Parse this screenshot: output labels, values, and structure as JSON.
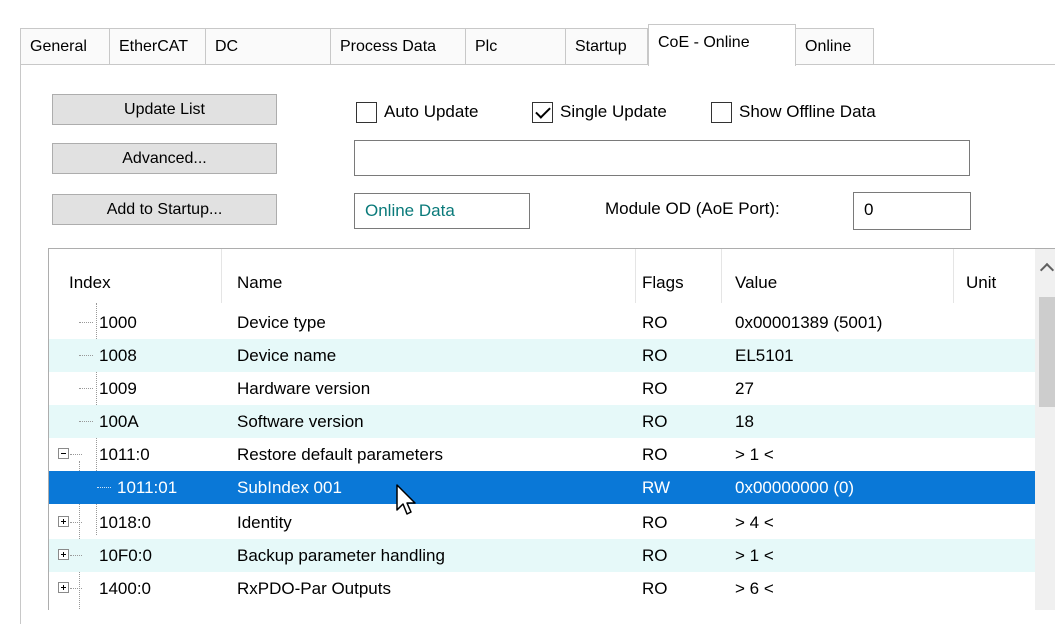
{
  "tabs": [
    {
      "label": "General",
      "active": false
    },
    {
      "label": "EtherCAT",
      "active": false
    },
    {
      "label": "DC",
      "active": false
    },
    {
      "label": "Process Data",
      "active": false
    },
    {
      "label": "Plc",
      "active": false
    },
    {
      "label": "Startup",
      "active": false
    },
    {
      "label": "CoE - Online",
      "active": true
    },
    {
      "label": "Online",
      "active": false
    }
  ],
  "buttons": {
    "update_list": "Update List",
    "advanced": "Advanced...",
    "add_to_startup": "Add to Startup..."
  },
  "checkboxes": {
    "auto_update": {
      "label": "Auto Update",
      "checked": false
    },
    "single_update": {
      "label": "Single Update",
      "checked": true
    },
    "show_offline": {
      "label": "Show Offline Data",
      "checked": false
    }
  },
  "fields": {
    "advanced_text": "",
    "online_data": "Online Data",
    "module_od_label": "Module OD (AoE Port):",
    "module_od_value": "0"
  },
  "table": {
    "headers": {
      "index": "Index",
      "name": "Name",
      "flags": "Flags",
      "value": "Value",
      "unit": "Unit"
    },
    "rows": [
      {
        "index": "1000",
        "name": "Device type",
        "flags": "RO",
        "value": "0x00001389 (5001)",
        "expander": "none",
        "level": 0
      },
      {
        "index": "1008",
        "name": "Device name",
        "flags": "RO",
        "value": "EL5101",
        "expander": "none",
        "level": 0
      },
      {
        "index": "1009",
        "name": "Hardware version",
        "flags": "RO",
        "value": "27",
        "expander": "none",
        "level": 0
      },
      {
        "index": "100A",
        "name": "Software version",
        "flags": "RO",
        "value": "18",
        "expander": "none",
        "level": 0
      },
      {
        "index": "1011:0",
        "name": "Restore default parameters",
        "flags": "RO",
        "value": "> 1 <",
        "expander": "minus",
        "level": 0
      },
      {
        "index": "1011:01",
        "name": "SubIndex 001",
        "flags": "RW",
        "value": "0x00000000 (0)",
        "expander": "none",
        "level": 1,
        "selected": true
      },
      {
        "index": "1018:0",
        "name": "Identity",
        "flags": "RO",
        "value": "> 4 <",
        "expander": "plus",
        "level": 0
      },
      {
        "index": "10F0:0",
        "name": "Backup parameter handling",
        "flags": "RO",
        "value": "> 1 <",
        "expander": "plus",
        "level": 0
      },
      {
        "index": "1400:0",
        "name": "RxPDO-Par Outputs",
        "flags": "RO",
        "value": "> 6 <",
        "expander": "plus",
        "level": 0
      }
    ]
  },
  "colors": {
    "selection": "#0a78d7",
    "alt_row": "#e6f9f9",
    "online_data_text": "#0a7a7a"
  }
}
